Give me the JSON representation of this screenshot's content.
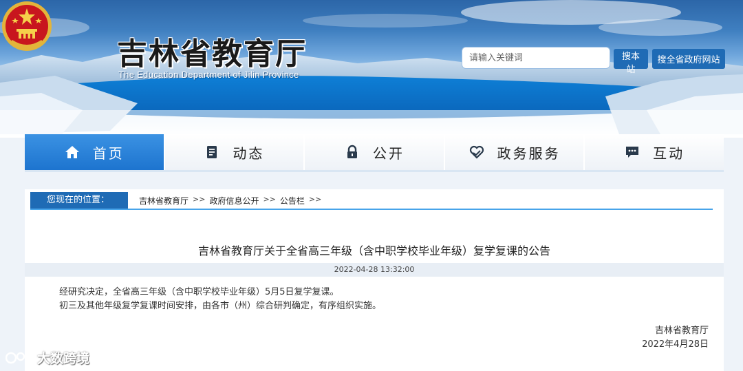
{
  "header": {
    "title_cn": "吉林省教育厅",
    "title_en": "The Education Department of Jilin Province",
    "search_placeholder": "请输入关键词",
    "search_site_label": "搜本站",
    "search_gov_label": "搜全省政府网站"
  },
  "nav": {
    "items": [
      {
        "label": "首页",
        "icon": "home-icon",
        "active": true
      },
      {
        "label": "动态",
        "icon": "document-icon",
        "active": false
      },
      {
        "label": "公开",
        "icon": "lock-icon",
        "active": false
      },
      {
        "label": "政务服务",
        "icon": "heart-hands-icon",
        "active": false
      },
      {
        "label": "互动",
        "icon": "chat-icon",
        "active": false
      }
    ]
  },
  "location": {
    "label": "您现在的位置：",
    "crumbs": [
      "吉林省教育厅",
      "政府信息公开",
      "公告栏"
    ],
    "separator": ">>"
  },
  "article": {
    "title": "吉林省教育厅关于全省高三年级（含中职学校毕业年级）复学复课的公告",
    "date": "2022-04-28 13:32:00",
    "paragraphs": [
      "经研究决定，全省高三年级（含中职学校毕业年级）5月5日复学复课。",
      "初三及其他年级复学复课时间安排，由各市（州）综合研判确定，有序组织实施。"
    ],
    "sign_org": "吉林省教育厅",
    "sign_date": "2022年4月28日"
  },
  "watermark": {
    "text": "大数跨境"
  },
  "colors": {
    "primary_blue": "#1f6bb5",
    "nav_active": "#1d74cf",
    "accent_line": "#47a4ea"
  }
}
